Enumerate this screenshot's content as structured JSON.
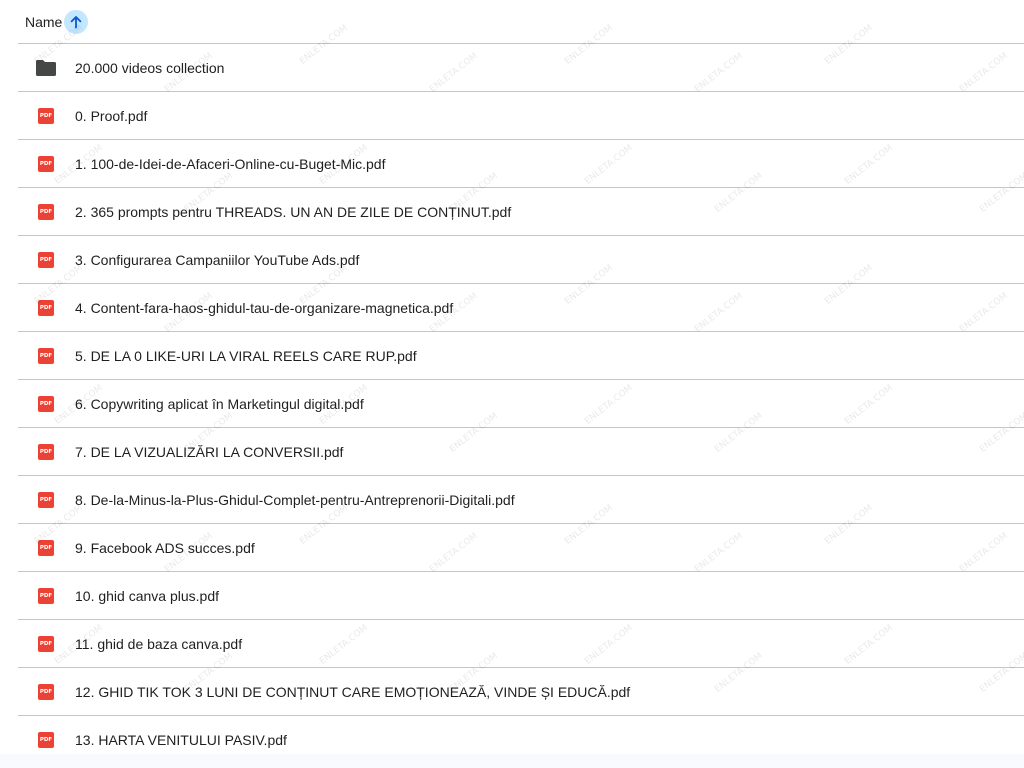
{
  "header": {
    "sort_label": "Name"
  },
  "icons": {
    "folder": "folder-icon",
    "pdf": "pdf-file-icon",
    "sort": "arrow-up-icon"
  },
  "pdf_badge": "PDF",
  "colors": {
    "pdf_red": "#ea4335",
    "folder_gray": "#444746",
    "sort_highlight": "#c2e7ff",
    "divider": "#c4c7c5"
  },
  "files": [
    {
      "name": "20.000 videos collection",
      "type": "folder"
    },
    {
      "name": "0. Proof.pdf",
      "type": "pdf"
    },
    {
      "name": "1. 100-de-Idei-de-Afaceri-Online-cu-Buget-Mic.pdf",
      "type": "pdf"
    },
    {
      "name": "2. 365 prompts pentru THREADS. UN AN DE ZILE DE CONȚINUT.pdf",
      "type": "pdf"
    },
    {
      "name": "3. Configurarea Campaniilor YouTube Ads.pdf",
      "type": "pdf"
    },
    {
      "name": "4. Content-fara-haos-ghidul-tau-de-organizare-magnetica.pdf",
      "type": "pdf"
    },
    {
      "name": "5. DE LA 0 LIKE-URI LA VIRAL REELS CARE RUP.pdf",
      "type": "pdf"
    },
    {
      "name": "6. Copywriting aplicat în Marketingul digital.pdf",
      "type": "pdf"
    },
    {
      "name": "7. DE LA VIZUALIZĂRI LA CONVERSII.pdf",
      "type": "pdf"
    },
    {
      "name": "8. De-la-Minus-la-Plus-Ghidul-Complet-pentru-Antreprenorii-Digitali.pdf",
      "type": "pdf"
    },
    {
      "name": "9. Facebook ADS succes.pdf",
      "type": "pdf"
    },
    {
      "name": "10. ghid canva plus.pdf",
      "type": "pdf"
    },
    {
      "name": "11. ghid de baza canva.pdf",
      "type": "pdf"
    },
    {
      "name": "12. GHID TIK TOK 3 LUNI DE CONȚINUT CARE EMOȚIONEAZĂ, VINDE ȘI EDUCĂ.pdf",
      "type": "pdf"
    },
    {
      "name": "13. HARTA VENITULUI PASIV.pdf",
      "type": "pdf"
    }
  ],
  "watermark_text": "ENLETA.COM"
}
